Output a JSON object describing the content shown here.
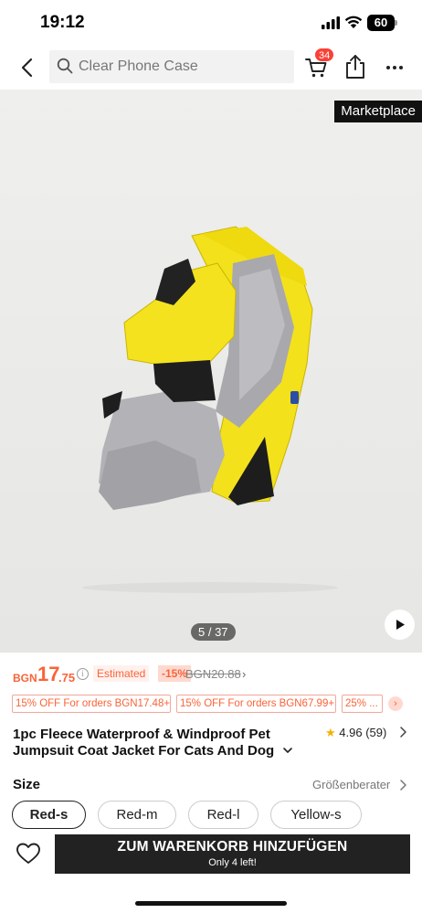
{
  "status_bar": {
    "time": "19:12",
    "battery": "60"
  },
  "header": {
    "search_placeholder": "Clear Phone Case",
    "cart_count": "34"
  },
  "gallery": {
    "badge": "Marketplace",
    "counter": "5 / 37"
  },
  "price": {
    "currency": "BGN",
    "integer": "17",
    "decimal": ".75",
    "estimated_label": "Estimated",
    "discount": "-15%",
    "original": "BGN20.88",
    "original_chevron": "›",
    "info_glyph": "i"
  },
  "coupons": [
    "15% OFF For orders BGN17.48+",
    "15% OFF For orders BGN67.99+",
    "25% ..."
  ],
  "coupon_more": "›",
  "product": {
    "title": "1pc Fleece Waterproof & Windproof Pet Jumpsuit Coat Jacket For Cats And Dog",
    "rating": "4.96",
    "reviews": "(59)",
    "star": "★"
  },
  "size": {
    "label": "Size",
    "guide": "Größenberater",
    "options": [
      "Red-s",
      "Red-m",
      "Red-l",
      "Yellow-s"
    ],
    "selected": "Red-s"
  },
  "cta": {
    "label": "ZUM WARENKORB HINZUFÜGEN",
    "sub": "Only 4 left!"
  },
  "colors": {
    "accent": "#fa6338",
    "badge_red": "#fa4137",
    "cta_bg": "#222222",
    "star": "#f4b000"
  },
  "icons": {
    "back": "chevron-left-icon",
    "search": "search-icon",
    "cart": "cart-icon",
    "share": "share-icon",
    "more": "more-horizontal-icon",
    "play": "play-icon",
    "info": "info-icon",
    "wishlist": "heart-icon"
  }
}
